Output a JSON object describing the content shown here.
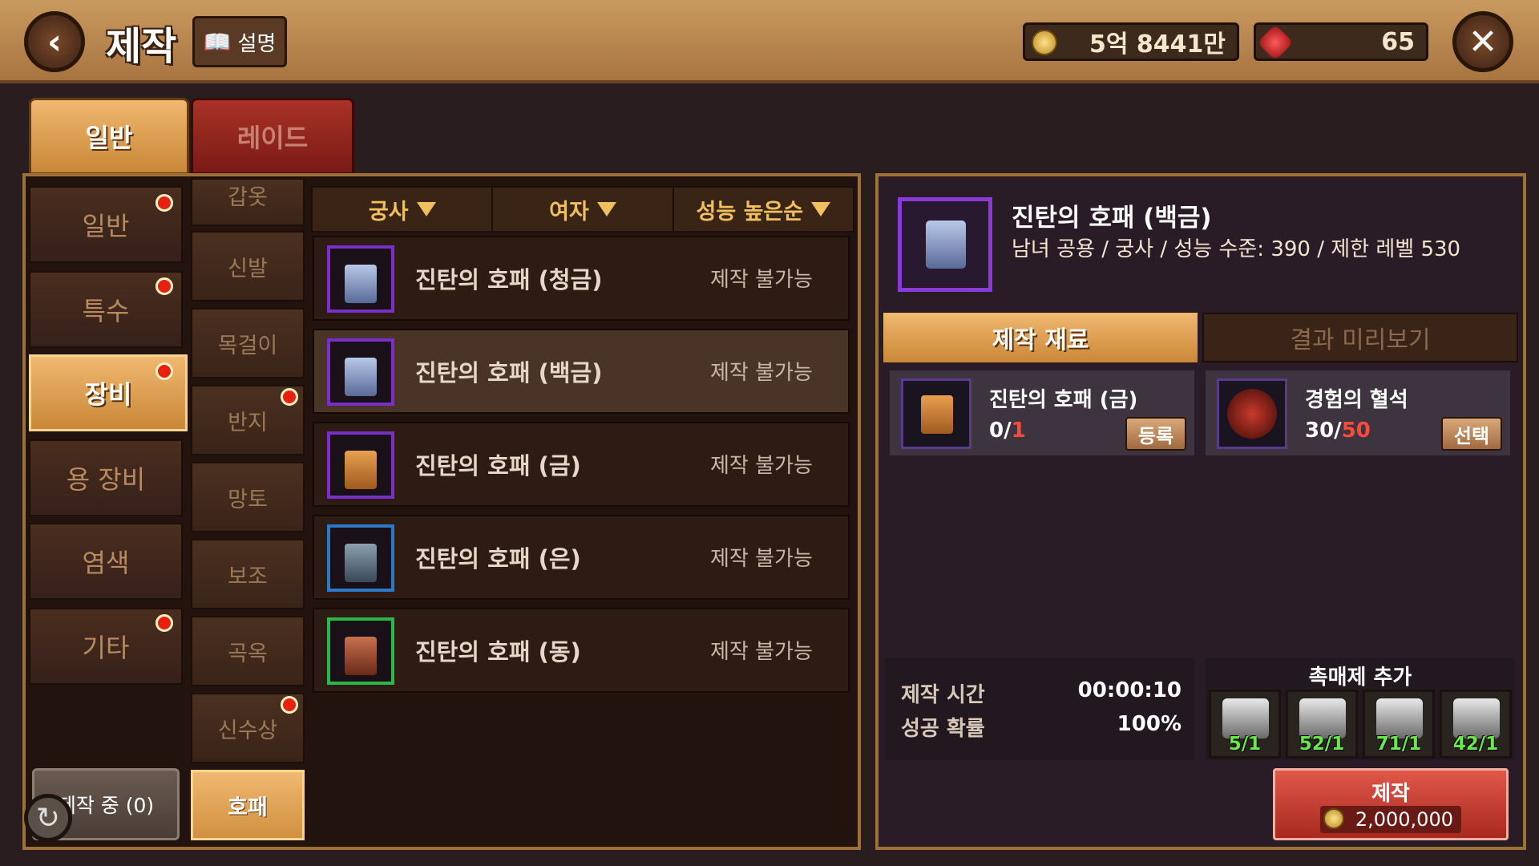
{
  "header": {
    "title": "제작",
    "help_label": "설명",
    "gold": "5억 8441만",
    "gems": "65"
  },
  "tabs": [
    {
      "label": "일반",
      "active": true
    },
    {
      "label": "레이드",
      "active": false
    }
  ],
  "categories": [
    {
      "label": "일반",
      "badge": true,
      "active": false
    },
    {
      "label": "특수",
      "badge": true,
      "active": false
    },
    {
      "label": "장비",
      "badge": true,
      "active": true
    },
    {
      "label": "용 장비",
      "badge": false,
      "active": false
    },
    {
      "label": "염색",
      "badge": false,
      "active": false
    },
    {
      "label": "기타",
      "badge": true,
      "active": false
    }
  ],
  "subcategories": [
    {
      "label": "갑옷",
      "badge": false
    },
    {
      "label": "신발",
      "badge": false
    },
    {
      "label": "목걸이",
      "badge": false
    },
    {
      "label": "반지",
      "badge": true
    },
    {
      "label": "망토",
      "badge": false
    },
    {
      "label": "보조",
      "badge": false
    },
    {
      "label": "곡옥",
      "badge": false
    },
    {
      "label": "신수상",
      "badge": true
    },
    {
      "label": "호패",
      "badge": false,
      "active": true
    }
  ],
  "crafting_queue_label": "제작 중 (0)",
  "filters": [
    {
      "label": "궁사"
    },
    {
      "label": "여자"
    },
    {
      "label": "성능 높은순"
    }
  ],
  "items": [
    {
      "name": "진탄의 호패 (청금)",
      "status": "제작 불가능",
      "grade": "plat"
    },
    {
      "name": "진탄의 호패 (백금)",
      "status": "제작 불가능",
      "grade": "plat"
    },
    {
      "name": "진탄의 호패 (금)",
      "status": "제작 불가능",
      "grade": "gold"
    },
    {
      "name": "진탄의 호패 (은)",
      "status": "제작 불가능",
      "grade": "silver"
    },
    {
      "name": "진탄의 호패 (동)",
      "status": "제작 불가능",
      "grade": "bronze"
    }
  ],
  "detail": {
    "name": "진탄의 호패 (백금)",
    "info": "남녀 공용 / 궁사 / 성능 수준: 390 / 제한 레벨 530",
    "tab_materials": "제작 재료",
    "tab_preview": "결과 미리보기"
  },
  "materials": [
    {
      "name": "진탄의 호패 (금)",
      "have": "0/",
      "need": "1",
      "button": "등록"
    },
    {
      "name": "경험의 혈석",
      "have": "30/",
      "need": "50",
      "button": "선택"
    }
  ],
  "craft_info": {
    "time_label": "제작 시간",
    "time_value": "00:00:10",
    "rate_label": "성공 확률",
    "rate_value": "100%"
  },
  "catalyst": {
    "title": "촉매제 추가",
    "slots": [
      "5/1",
      "52/1",
      "71/1",
      "42/1"
    ]
  },
  "craft_button": {
    "label": "제작",
    "cost": "2,000,000"
  },
  "colors": {
    "accent_orange": "#c98838",
    "raid_red": "#7a1a14",
    "badge_red": "#e82010",
    "need_red": "#ff4a3a",
    "catalyst_green": "#6ae84a"
  }
}
